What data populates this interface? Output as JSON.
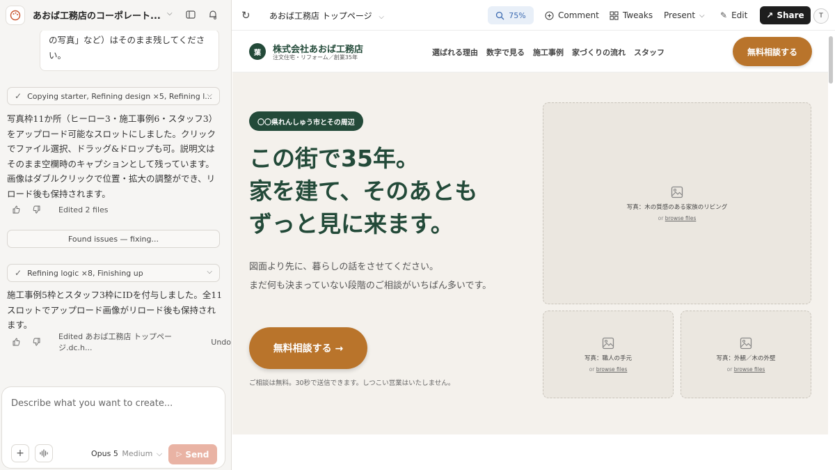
{
  "app": {
    "project_title": "あおば工務店のコーポレート...",
    "colors": {
      "accent_green": "#234a39",
      "accent_orange": "#b9742b",
      "send_disabled": "#e9b3a4"
    }
  },
  "chat": {
    "user_message": "の写真」など）はそのまま残してください。",
    "step1": "Copying starter, Refining design ×5, Refining l...",
    "msg1": "写真枠11か所（ヒーロー3・施工事例6・スタッフ3）をアップロード可能なスロットにしました。クリックでファイル選択、ドラッグ&ドロップも可。説明文はそのまま空欄時のキャプションとして残っています。画像はダブルクリックで位置・拡大の調整ができ、リロード後も保持されます。",
    "actions1_edited": "Edited 2 files",
    "found_issues": "Found issues — fixing...",
    "step2": "Refining logic ×8, Finishing up",
    "msg2": "施工事例5枠とスタッフ3枠にIDを付与しました。全11スロットでアップロード画像がリロード後も保持されます。",
    "actions2_edited": "Edited あおば工務店 トップページ.dc.h...",
    "actions2_undo": "Undo"
  },
  "composer": {
    "placeholder": "Describe what you want to create...",
    "model": "Opus 5",
    "level": "Medium",
    "send": "Send"
  },
  "toolbar": {
    "page_title": "あおば工務店 トップページ",
    "zoom": "75%",
    "comment": "Comment",
    "tweaks": "Tweaks",
    "present": "Present",
    "edit": "Edit",
    "share": "Share",
    "avatar": "T"
  },
  "site": {
    "logo_mark": "葉",
    "logo_name": "株式会社あおば工務店",
    "logo_sub": "注文住宅・リフォーム／創業35年",
    "nav": [
      "選ばれる理由",
      "数字で見る",
      "施工事例",
      "家づくりの流れ",
      "スタッフ"
    ],
    "nav_cta": "無料相談する",
    "badge": "〇〇県れんしゅう市とその周辺",
    "headline": [
      "この街で35年。",
      "家を建て、そのあとも",
      "ずっと見に来ます。"
    ],
    "lead": [
      "図面より先に、暮らしの話をさせてください。",
      "まだ何も決まっていない段階のご相談がいちばん多いです。"
    ],
    "hero_cta": "無料相談する →",
    "note": "ご相談は無料。30秒で送信できます。しつこい営業はいたしません。",
    "slots": [
      {
        "caption": "写真：木の質感のある家族のリビング",
        "or": "or",
        "browse": "browse files"
      },
      {
        "caption": "写真：職人の手元",
        "or": "or",
        "browse": "browse files"
      },
      {
        "caption": "写真：外観／木の外壁",
        "or": "or",
        "browse": "browse files"
      }
    ]
  }
}
